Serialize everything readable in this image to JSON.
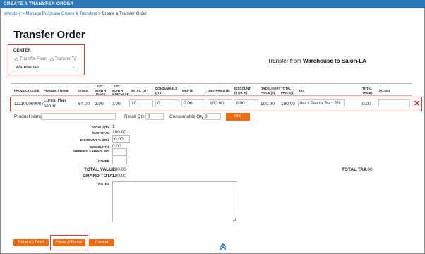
{
  "window": {
    "title": "CREATE A TRANSFER ORDER"
  },
  "breadcrumb": {
    "items": [
      "Inventory",
      "Manage Purchase Orders & Transfers",
      "Create a Transfer Order"
    ],
    "separator": ">"
  },
  "page_title": "Transfer Order",
  "center": {
    "label": "CENTER",
    "radio_from": "Transfer From",
    "radio_to": "Transfer To",
    "selected": "Warehouse"
  },
  "transfer_heading": {
    "prefix": "Transfer from ",
    "route": "Warehouse to Salon-LA"
  },
  "table": {
    "headers": {
      "product_code": "PRODUCT CODE",
      "product_name": "PRODUCT NAME",
      "stock": "STOCK",
      "last_month_usage_1": "LAST",
      "last_month_usage_2": "MONTH",
      "last_month_usage_3": "USAGE",
      "last_month_purchase_1": "LAST",
      "last_month_purchase_2": "MONTH",
      "last_month_purchase_3": "PURCHASE",
      "retail_qty": "RETAIL QTY",
      "consumable_qty_1": "CONSUMABLE",
      "consumable_qty_2": "QTY",
      "mrp": "MRP ($)",
      "unit_price": "UNIT PRICE ($)",
      "discount_1": "DISCOUNT",
      "discount_2": "($ or %)",
      "ondelivery_1": "ONDELIVERY",
      "ondelivery_2": "PRICE ($)",
      "total_price_1": "TOTAL",
      "total_price_2": "PRICE($)",
      "tax": "TAX",
      "total_tax_1": "TOTAL",
      "total_tax_2": "TAX($)",
      "notes": "NOTES"
    },
    "row": {
      "product_code": "111100000007",
      "product_name_1": "Loreal Hair",
      "product_name_2": "serum",
      "stock": "64.00",
      "last_month_usage": "2.00",
      "last_month_purchase": "0.00",
      "retail_qty": "10",
      "consumable_qty": "0",
      "mrp": "0.00",
      "unit_price": "100.00",
      "discount": "0.00",
      "ondelivery_price": "100.00",
      "total_price": "100.00",
      "tax": "Itax ( County Tax - 0%",
      "total_tax": "0.00",
      "notes": ""
    }
  },
  "add_row": {
    "product_name_label": "Product Name",
    "product_name_value": "",
    "retail_qty_label": "Retail Qty",
    "retail_qty_value": "0",
    "consumable_qty_label": "Consumable Qty",
    "consumable_qty_value": "0",
    "add_button": "Add"
  },
  "summary": {
    "total_qty_label": "Total Qty",
    "total_qty": "1",
    "subtotal_label": "SUBTOTAL",
    "subtotal": "100.00",
    "discount_label": "DISCOUNT % or $",
    "discount_input": "0.00",
    "discount_dollar_label": "DISCOUNT $",
    "discount_dollar": "0.00",
    "shipping_label": "SHIPPING & HANDLING",
    "shipping_input": "",
    "other_label": "OTHER",
    "other_input": "",
    "total_value_label": "TOTAL VALUE",
    "total_value": "100.00",
    "grand_total_label": "GRAND TOTAL",
    "grand_total": "100.00",
    "total_tax_label": "TOTAL TAX",
    "total_tax": "0.00",
    "notes_label": "NOTES"
  },
  "buttons": {
    "save_draft": "Save As Draft",
    "save_raise": "Save & Raise",
    "cancel": "Cancel"
  },
  "icons": {
    "scroll_up": "double-chevron-up-icon",
    "delete": "delete-x-icon",
    "dropdown": "chevron-down-icon"
  },
  "colors": {
    "header_bar": "#2e78b7",
    "button": "#f26a0e",
    "highlight": "#e23b3b",
    "link": "#1f6fb5",
    "delete": "#d62020",
    "scroll_icon": "#2e78b7"
  }
}
